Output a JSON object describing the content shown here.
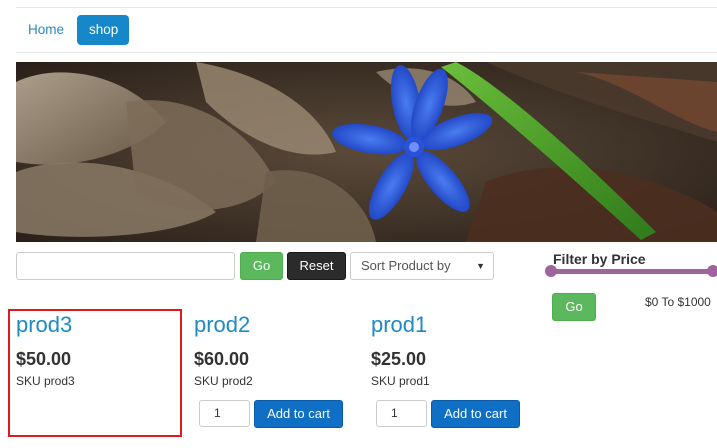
{
  "nav": {
    "items": [
      {
        "label": "Home"
      },
      {
        "label": "shop"
      }
    ]
  },
  "banner": {
    "image_subject": "blue-flower-on-leaves"
  },
  "search": {
    "input_value": "",
    "go_label": "Go",
    "reset_label": "Reset",
    "sort_label": "Sort Product by"
  },
  "filter": {
    "title": "Filter by Price",
    "go_label": "Go",
    "range_text": "$0 To $1000",
    "min_value": 0,
    "max_value": 1000,
    "accent_color": "#a0649c"
  },
  "products": [
    {
      "name": "prod3",
      "price": "$50.00",
      "sku": "SKU prod3"
    },
    {
      "name": "prod2",
      "price": "$60.00",
      "sku": "SKU prod2",
      "qty": "1",
      "cart_label": "Add to cart"
    },
    {
      "name": "prod1",
      "price": "$25.00",
      "sku": "SKU prod1",
      "qty": "1",
      "cart_label": "Add to cart"
    }
  ],
  "colors": {
    "link": "#2a8ac0",
    "active_nav": "#1688c9",
    "go_button": "#5cb85c",
    "reset_button": "#2b2b2b",
    "cart_button": "#0e6fc5",
    "highlight": "#e0191c"
  }
}
